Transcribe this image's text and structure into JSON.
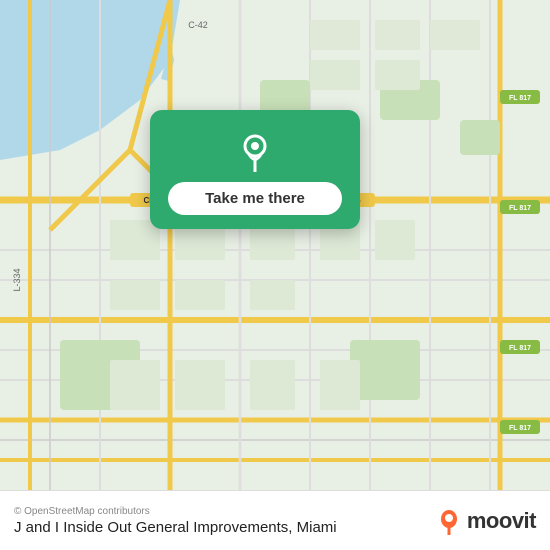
{
  "map": {
    "background_color": "#e8efe8",
    "water_color": "#a8d8e8",
    "road_color": "#f5d97a",
    "grid_color": "#d0d8c8"
  },
  "popup": {
    "background_color": "#2eaa6e",
    "button_label": "Take me there",
    "button_bg": "#ffffff",
    "pin_color": "#ffffff"
  },
  "bottom_bar": {
    "osm_credit": "© OpenStreetMap contributors",
    "location_label": "J and I Inside Out General Improvements, Miami",
    "moovit_text": "moovit"
  }
}
